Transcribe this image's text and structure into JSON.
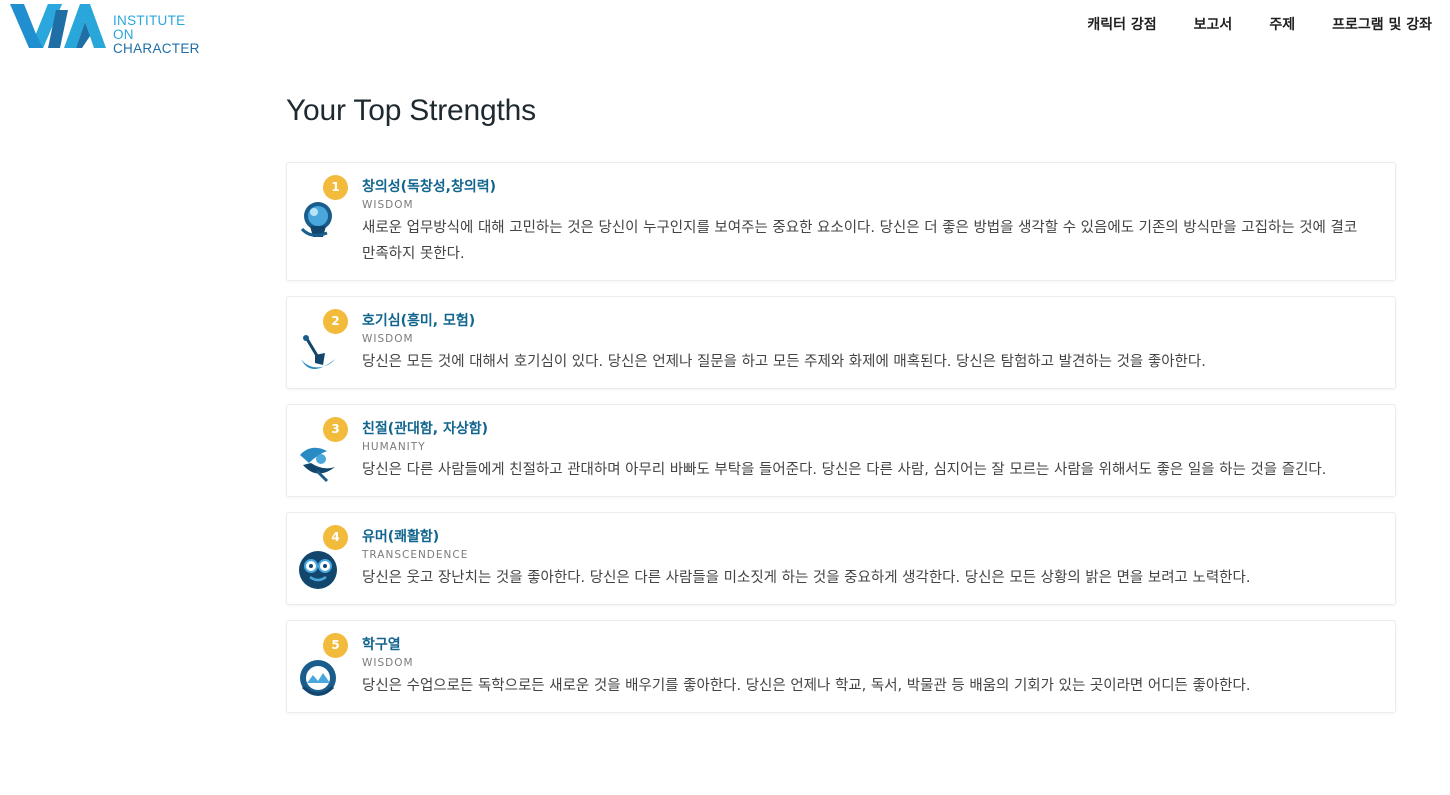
{
  "header": {
    "logo_line1": "INSTITUTE ON",
    "logo_line2": "CHARACTER",
    "nav": [
      "캐릭터 강점",
      "보고서",
      "주제",
      "프로그램 및 강좌"
    ]
  },
  "page_title": "Your Top Strengths",
  "strengths": [
    {
      "rank": "1",
      "name": "창의성(독창성,창의력)",
      "virtue": "WISDOM",
      "icon": "lightbulb-icon",
      "description": "새로운 업무방식에 대해 고민하는 것은 당신이 누구인지를 보여주는 중요한 요소이다. 당신은 더 좋은 방법을 생각할 수 있음에도 기존의 방식만을 고집하는 것에 결코 만족하지 못한다."
    },
    {
      "rank": "2",
      "name": "호기심(흥미, 모험)",
      "virtue": "WISDOM",
      "icon": "shovel-icon",
      "description": "당신은 모든 것에 대해서 호기심이 있다. 당신은 언제나 질문을 하고 모든 주제와 화제에 매혹된다. 당신은 탐험하고 발견하는 것을 좋아한다."
    },
    {
      "rank": "3",
      "name": "친절(관대함, 자상함)",
      "virtue": "HUMANITY",
      "icon": "caring-hands-icon",
      "description": "당신은 다른 사람들에게 친절하고 관대하며 아무리 바빠도 부탁을 들어준다. 당신은 다른 사람, 심지어는 잘 모르는 사람을 위해서도 좋은 일을 하는 것을 즐긴다."
    },
    {
      "rank": "4",
      "name": "유머(쾌활함)",
      "virtue": "TRANSCENDENCE",
      "icon": "funny-glasses-icon",
      "description": "당신은 웃고 장난치는 것을 좋아한다. 당신은 다른 사람들을 미소짓게 하는 것을 중요하게 생각한다. 당신은 모든 상황의 밝은 면을 보려고 노력한다."
    },
    {
      "rank": "5",
      "name": "학구열",
      "virtue": "WISDOM",
      "icon": "learning-icon",
      "description": "당신은 수업으로든 독학으로든 새로운 것을 배우기를 좋아한다. 당신은 언제나 학교, 독서, 박물관 등 배움의 기회가 있는 곳이라면 어디든 좋아한다."
    }
  ],
  "colors": {
    "rank_badge": "#f2bb3b",
    "strength_name": "#12658f",
    "logo_light": "#29a7db",
    "logo_dark": "#1f6ea6"
  }
}
